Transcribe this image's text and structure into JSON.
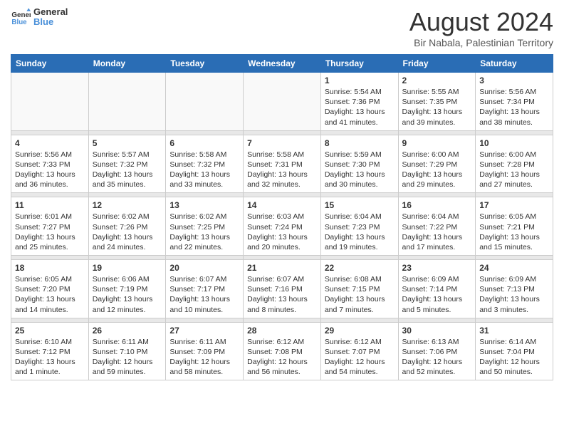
{
  "header": {
    "logo_line1": "General",
    "logo_line2": "Blue",
    "month_year": "August 2024",
    "location": "Bir Nabala, Palestinian Territory"
  },
  "weekdays": [
    "Sunday",
    "Monday",
    "Tuesday",
    "Wednesday",
    "Thursday",
    "Friday",
    "Saturday"
  ],
  "weeks": [
    [
      {
        "day": "",
        "info": ""
      },
      {
        "day": "",
        "info": ""
      },
      {
        "day": "",
        "info": ""
      },
      {
        "day": "",
        "info": ""
      },
      {
        "day": "1",
        "info": "Sunrise: 5:54 AM\nSunset: 7:36 PM\nDaylight: 13 hours\nand 41 minutes."
      },
      {
        "day": "2",
        "info": "Sunrise: 5:55 AM\nSunset: 7:35 PM\nDaylight: 13 hours\nand 39 minutes."
      },
      {
        "day": "3",
        "info": "Sunrise: 5:56 AM\nSunset: 7:34 PM\nDaylight: 13 hours\nand 38 minutes."
      }
    ],
    [
      {
        "day": "4",
        "info": "Sunrise: 5:56 AM\nSunset: 7:33 PM\nDaylight: 13 hours\nand 36 minutes."
      },
      {
        "day": "5",
        "info": "Sunrise: 5:57 AM\nSunset: 7:32 PM\nDaylight: 13 hours\nand 35 minutes."
      },
      {
        "day": "6",
        "info": "Sunrise: 5:58 AM\nSunset: 7:32 PM\nDaylight: 13 hours\nand 33 minutes."
      },
      {
        "day": "7",
        "info": "Sunrise: 5:58 AM\nSunset: 7:31 PM\nDaylight: 13 hours\nand 32 minutes."
      },
      {
        "day": "8",
        "info": "Sunrise: 5:59 AM\nSunset: 7:30 PM\nDaylight: 13 hours\nand 30 minutes."
      },
      {
        "day": "9",
        "info": "Sunrise: 6:00 AM\nSunset: 7:29 PM\nDaylight: 13 hours\nand 29 minutes."
      },
      {
        "day": "10",
        "info": "Sunrise: 6:00 AM\nSunset: 7:28 PM\nDaylight: 13 hours\nand 27 minutes."
      }
    ],
    [
      {
        "day": "11",
        "info": "Sunrise: 6:01 AM\nSunset: 7:27 PM\nDaylight: 13 hours\nand 25 minutes."
      },
      {
        "day": "12",
        "info": "Sunrise: 6:02 AM\nSunset: 7:26 PM\nDaylight: 13 hours\nand 24 minutes."
      },
      {
        "day": "13",
        "info": "Sunrise: 6:02 AM\nSunset: 7:25 PM\nDaylight: 13 hours\nand 22 minutes."
      },
      {
        "day": "14",
        "info": "Sunrise: 6:03 AM\nSunset: 7:24 PM\nDaylight: 13 hours\nand 20 minutes."
      },
      {
        "day": "15",
        "info": "Sunrise: 6:04 AM\nSunset: 7:23 PM\nDaylight: 13 hours\nand 19 minutes."
      },
      {
        "day": "16",
        "info": "Sunrise: 6:04 AM\nSunset: 7:22 PM\nDaylight: 13 hours\nand 17 minutes."
      },
      {
        "day": "17",
        "info": "Sunrise: 6:05 AM\nSunset: 7:21 PM\nDaylight: 13 hours\nand 15 minutes."
      }
    ],
    [
      {
        "day": "18",
        "info": "Sunrise: 6:05 AM\nSunset: 7:20 PM\nDaylight: 13 hours\nand 14 minutes."
      },
      {
        "day": "19",
        "info": "Sunrise: 6:06 AM\nSunset: 7:19 PM\nDaylight: 13 hours\nand 12 minutes."
      },
      {
        "day": "20",
        "info": "Sunrise: 6:07 AM\nSunset: 7:17 PM\nDaylight: 13 hours\nand 10 minutes."
      },
      {
        "day": "21",
        "info": "Sunrise: 6:07 AM\nSunset: 7:16 PM\nDaylight: 13 hours\nand 8 minutes."
      },
      {
        "day": "22",
        "info": "Sunrise: 6:08 AM\nSunset: 7:15 PM\nDaylight: 13 hours\nand 7 minutes."
      },
      {
        "day": "23",
        "info": "Sunrise: 6:09 AM\nSunset: 7:14 PM\nDaylight: 13 hours\nand 5 minutes."
      },
      {
        "day": "24",
        "info": "Sunrise: 6:09 AM\nSunset: 7:13 PM\nDaylight: 13 hours\nand 3 minutes."
      }
    ],
    [
      {
        "day": "25",
        "info": "Sunrise: 6:10 AM\nSunset: 7:12 PM\nDaylight: 13 hours\nand 1 minute."
      },
      {
        "day": "26",
        "info": "Sunrise: 6:11 AM\nSunset: 7:10 PM\nDaylight: 12 hours\nand 59 minutes."
      },
      {
        "day": "27",
        "info": "Sunrise: 6:11 AM\nSunset: 7:09 PM\nDaylight: 12 hours\nand 58 minutes."
      },
      {
        "day": "28",
        "info": "Sunrise: 6:12 AM\nSunset: 7:08 PM\nDaylight: 12 hours\nand 56 minutes."
      },
      {
        "day": "29",
        "info": "Sunrise: 6:12 AM\nSunset: 7:07 PM\nDaylight: 12 hours\nand 54 minutes."
      },
      {
        "day": "30",
        "info": "Sunrise: 6:13 AM\nSunset: 7:06 PM\nDaylight: 12 hours\nand 52 minutes."
      },
      {
        "day": "31",
        "info": "Sunrise: 6:14 AM\nSunset: 7:04 PM\nDaylight: 12 hours\nand 50 minutes."
      }
    ]
  ]
}
